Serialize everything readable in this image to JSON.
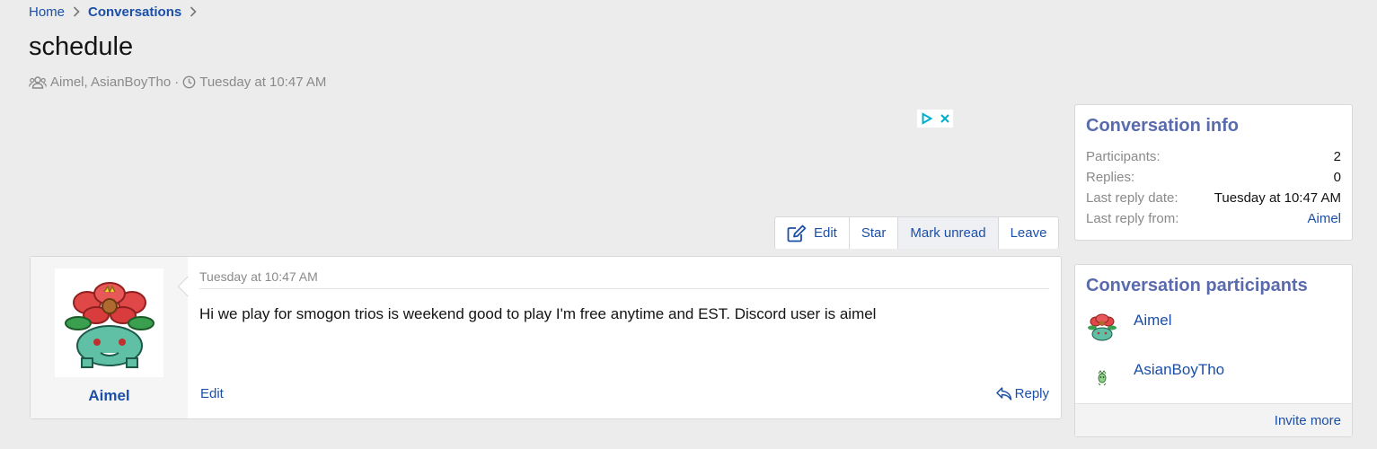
{
  "breadcrumb": {
    "items": [
      {
        "label": "Home"
      },
      {
        "label": "Conversations"
      }
    ]
  },
  "page": {
    "title": "schedule",
    "participants_text": "Aimel, AsianBoyTho",
    "separator": "·",
    "timestamp": "Tuesday at 10:47 AM"
  },
  "actions": {
    "edit": "Edit",
    "star": "Star",
    "mark_unread": "Mark unread",
    "leave": "Leave"
  },
  "message": {
    "author": "Aimel",
    "date": "Tuesday at 10:47 AM",
    "body": "Hi we play for smogon trios is weekend good to play I'm free anytime and EST. Discord user is aimel",
    "edit_label": "Edit",
    "reply_label": "Reply"
  },
  "info": {
    "title": "Conversation info",
    "rows": [
      {
        "key": "Participants:",
        "value": "2"
      },
      {
        "key": "Replies:",
        "value": "0"
      },
      {
        "key": "Last reply date:",
        "value": "Tuesday at 10:47 AM"
      },
      {
        "key": "Last reply from:",
        "value": "Aimel"
      }
    ]
  },
  "participants": {
    "title": "Conversation participants",
    "items": [
      {
        "name": "Aimel"
      },
      {
        "name": "AsianBoyTho"
      }
    ],
    "invite_label": "Invite more"
  },
  "colors": {
    "link": "#1b4fa8",
    "block_title": "#5a6bad",
    "background": "#ececec"
  },
  "icons": [
    "chevron-right-icon",
    "users-icon",
    "clock-icon",
    "edit-icon",
    "reply-icon",
    "ad-play-icon",
    "ad-close-icon"
  ]
}
